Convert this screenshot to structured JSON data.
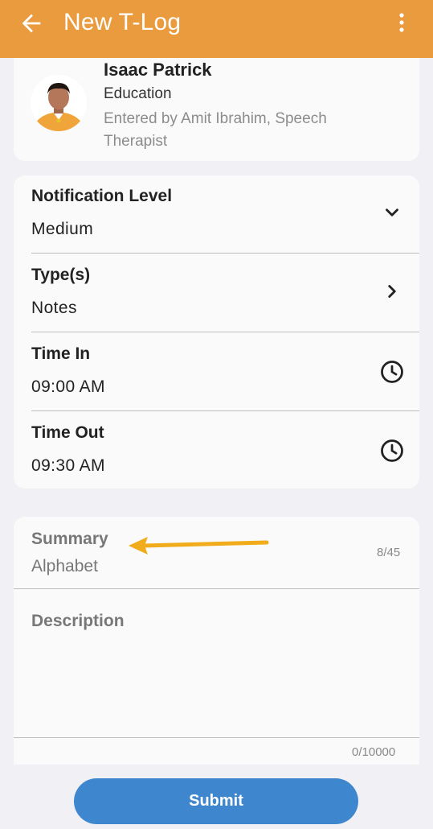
{
  "appbar": {
    "title": "New T-Log",
    "back_icon": "arrow-left-icon",
    "menu_icon": "more-vertical-icon",
    "color": "#e99b3e"
  },
  "profile": {
    "name": "Isaac Patrick",
    "role": "Education",
    "entered_by": "Entered by Amit Ibrahim, Speech Therapist"
  },
  "fields": [
    {
      "label": "Notification Level",
      "value": "Medium",
      "icon": "chevron-down-icon"
    },
    {
      "label": "Type(s)",
      "value": "Notes",
      "icon": "chevron-right-icon"
    },
    {
      "label": "Time In",
      "value": "09:00 AM",
      "icon": "clock-icon"
    },
    {
      "label": "Time Out",
      "value": "09:30 AM",
      "icon": "clock-icon"
    }
  ],
  "summary": {
    "label": "Summary",
    "value": "Alphabet",
    "counter": "8/45"
  },
  "description": {
    "label": "Description",
    "counter": "0/10000"
  },
  "submit": {
    "label": "Submit",
    "color": "#3e87cf"
  },
  "annotation": {
    "arrow_color": "#f0ac1a"
  }
}
